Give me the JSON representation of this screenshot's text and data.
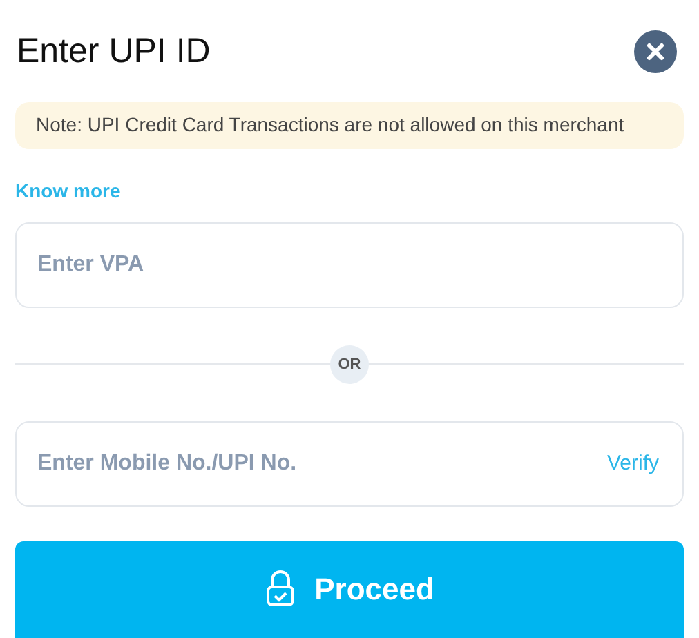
{
  "title": "Enter UPI ID",
  "note": "Note: UPI Credit Card Transactions are not allowed on this merchant",
  "know_more": "Know more",
  "vpa_field": {
    "placeholder": "Enter VPA"
  },
  "divider": "OR",
  "mobile_field": {
    "placeholder": "Enter Mobile No./UPI No.",
    "action": "Verify"
  },
  "proceed_button": "Proceed"
}
